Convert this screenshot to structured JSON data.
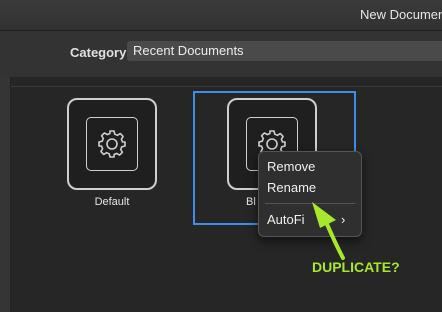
{
  "window": {
    "title": "New Document"
  },
  "header": {
    "category_label": "Category",
    "category_value": "Recent Documents"
  },
  "templates": [
    {
      "label": "Default",
      "icon": "gear-icon"
    },
    {
      "label": "Bl",
      "icon": "gear-icon"
    }
  ],
  "context_menu": {
    "items": [
      "Remove",
      "Rename",
      "AutoFi"
    ],
    "submenu_indicator": "chevron-right-icon"
  },
  "annotation": {
    "text": "DUPLICATE?",
    "color": "#a7e82a"
  },
  "colors": {
    "selection": "#3d8ee8",
    "background": "#262626"
  }
}
